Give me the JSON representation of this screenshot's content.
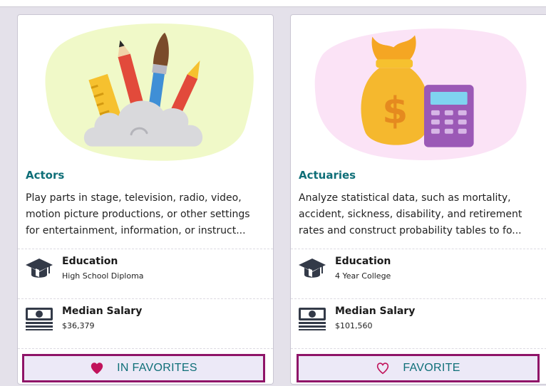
{
  "cards": [
    {
      "title": "Actors",
      "illustration": "art-supplies-cloud-illustration",
      "description_lines": [
        "Play parts in stage, television, radio, video,",
        "motion picture productions, or other settings",
        "for entertainment, information, or instruct..."
      ],
      "education": {
        "label": "Education",
        "value": "High School Diploma",
        "icon": "graduation-cap-icon"
      },
      "salary": {
        "label": "Median Salary",
        "value": "$36,379",
        "icon": "money-stack-icon"
      },
      "favorite": {
        "label": "IN FAVORITES",
        "icon": "heart-filled-icon",
        "state": "favorited"
      }
    },
    {
      "title": "Actuaries",
      "illustration": "money-bag-calculator-illustration",
      "description_lines": [
        "Analyze statistical data, such as mortality,",
        "accident, sickness, disability, and retirement",
        "rates and construct probability tables to fo..."
      ],
      "education": {
        "label": "Education",
        "value": "4 Year College",
        "icon": "graduation-cap-icon"
      },
      "salary": {
        "label": "Median Salary",
        "value": "$101,560",
        "icon": "money-stack-icon"
      },
      "favorite": {
        "label": "FAVORITE",
        "icon": "heart-outline-icon",
        "state": "not-favorited"
      }
    }
  ],
  "colors": {
    "title": "#0f6f78",
    "button_border": "#8f1468",
    "button_bg": "#ece9f7",
    "heart": "#c1135b",
    "icon_dark": "#333a48"
  }
}
